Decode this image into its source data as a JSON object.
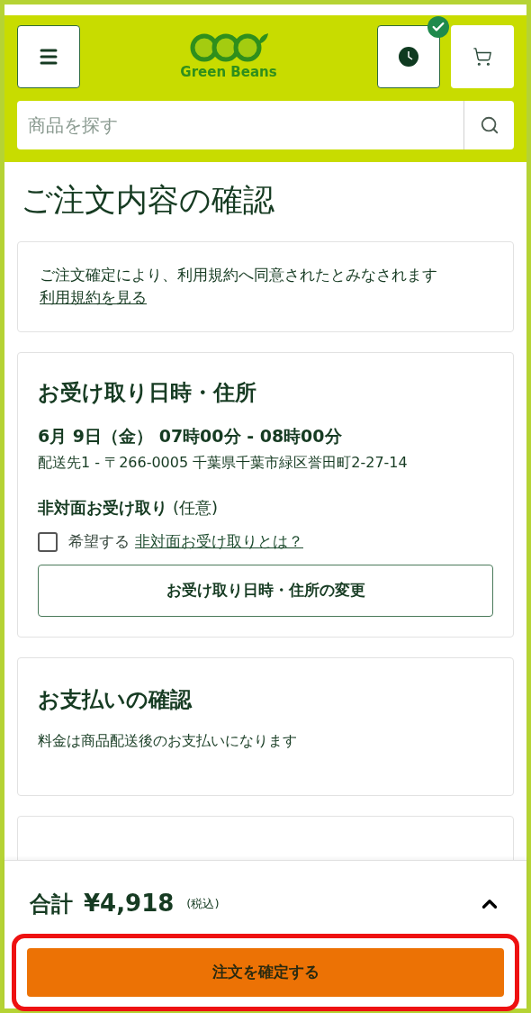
{
  "header": {
    "logo_text": "Green Beans",
    "search": {
      "placeholder": "商品を探す"
    }
  },
  "page_title": "ご注文内容の確認",
  "terms": {
    "text": "ご注文確定により、利用規約へ同意されたとみなされます",
    "link": "利用規約を見る"
  },
  "delivery": {
    "title": "お受け取り日時・住所",
    "datetime": "6月 9日（金） 07時00分 - 08時00分",
    "address": "配送先1 - 〒266-0005 千葉県千葉市緑区誉田町2-27-14",
    "contactless_label": "非対面お受け取り",
    "contactless_note": "(任意)",
    "checkbox": {
      "label": "希望する",
      "checked": false
    },
    "help_link": "非対面お受け取りとは？",
    "change_button": "お受け取り日時・住所の変更"
  },
  "payment": {
    "title": "お支払いの確認",
    "text": "料金は商品配送後のお支払いになります"
  },
  "footer": {
    "total_label": "合計",
    "total": "¥4,918",
    "tax_note": "(税込)",
    "expanded": false,
    "confirm_button": "注文を確定する"
  }
}
